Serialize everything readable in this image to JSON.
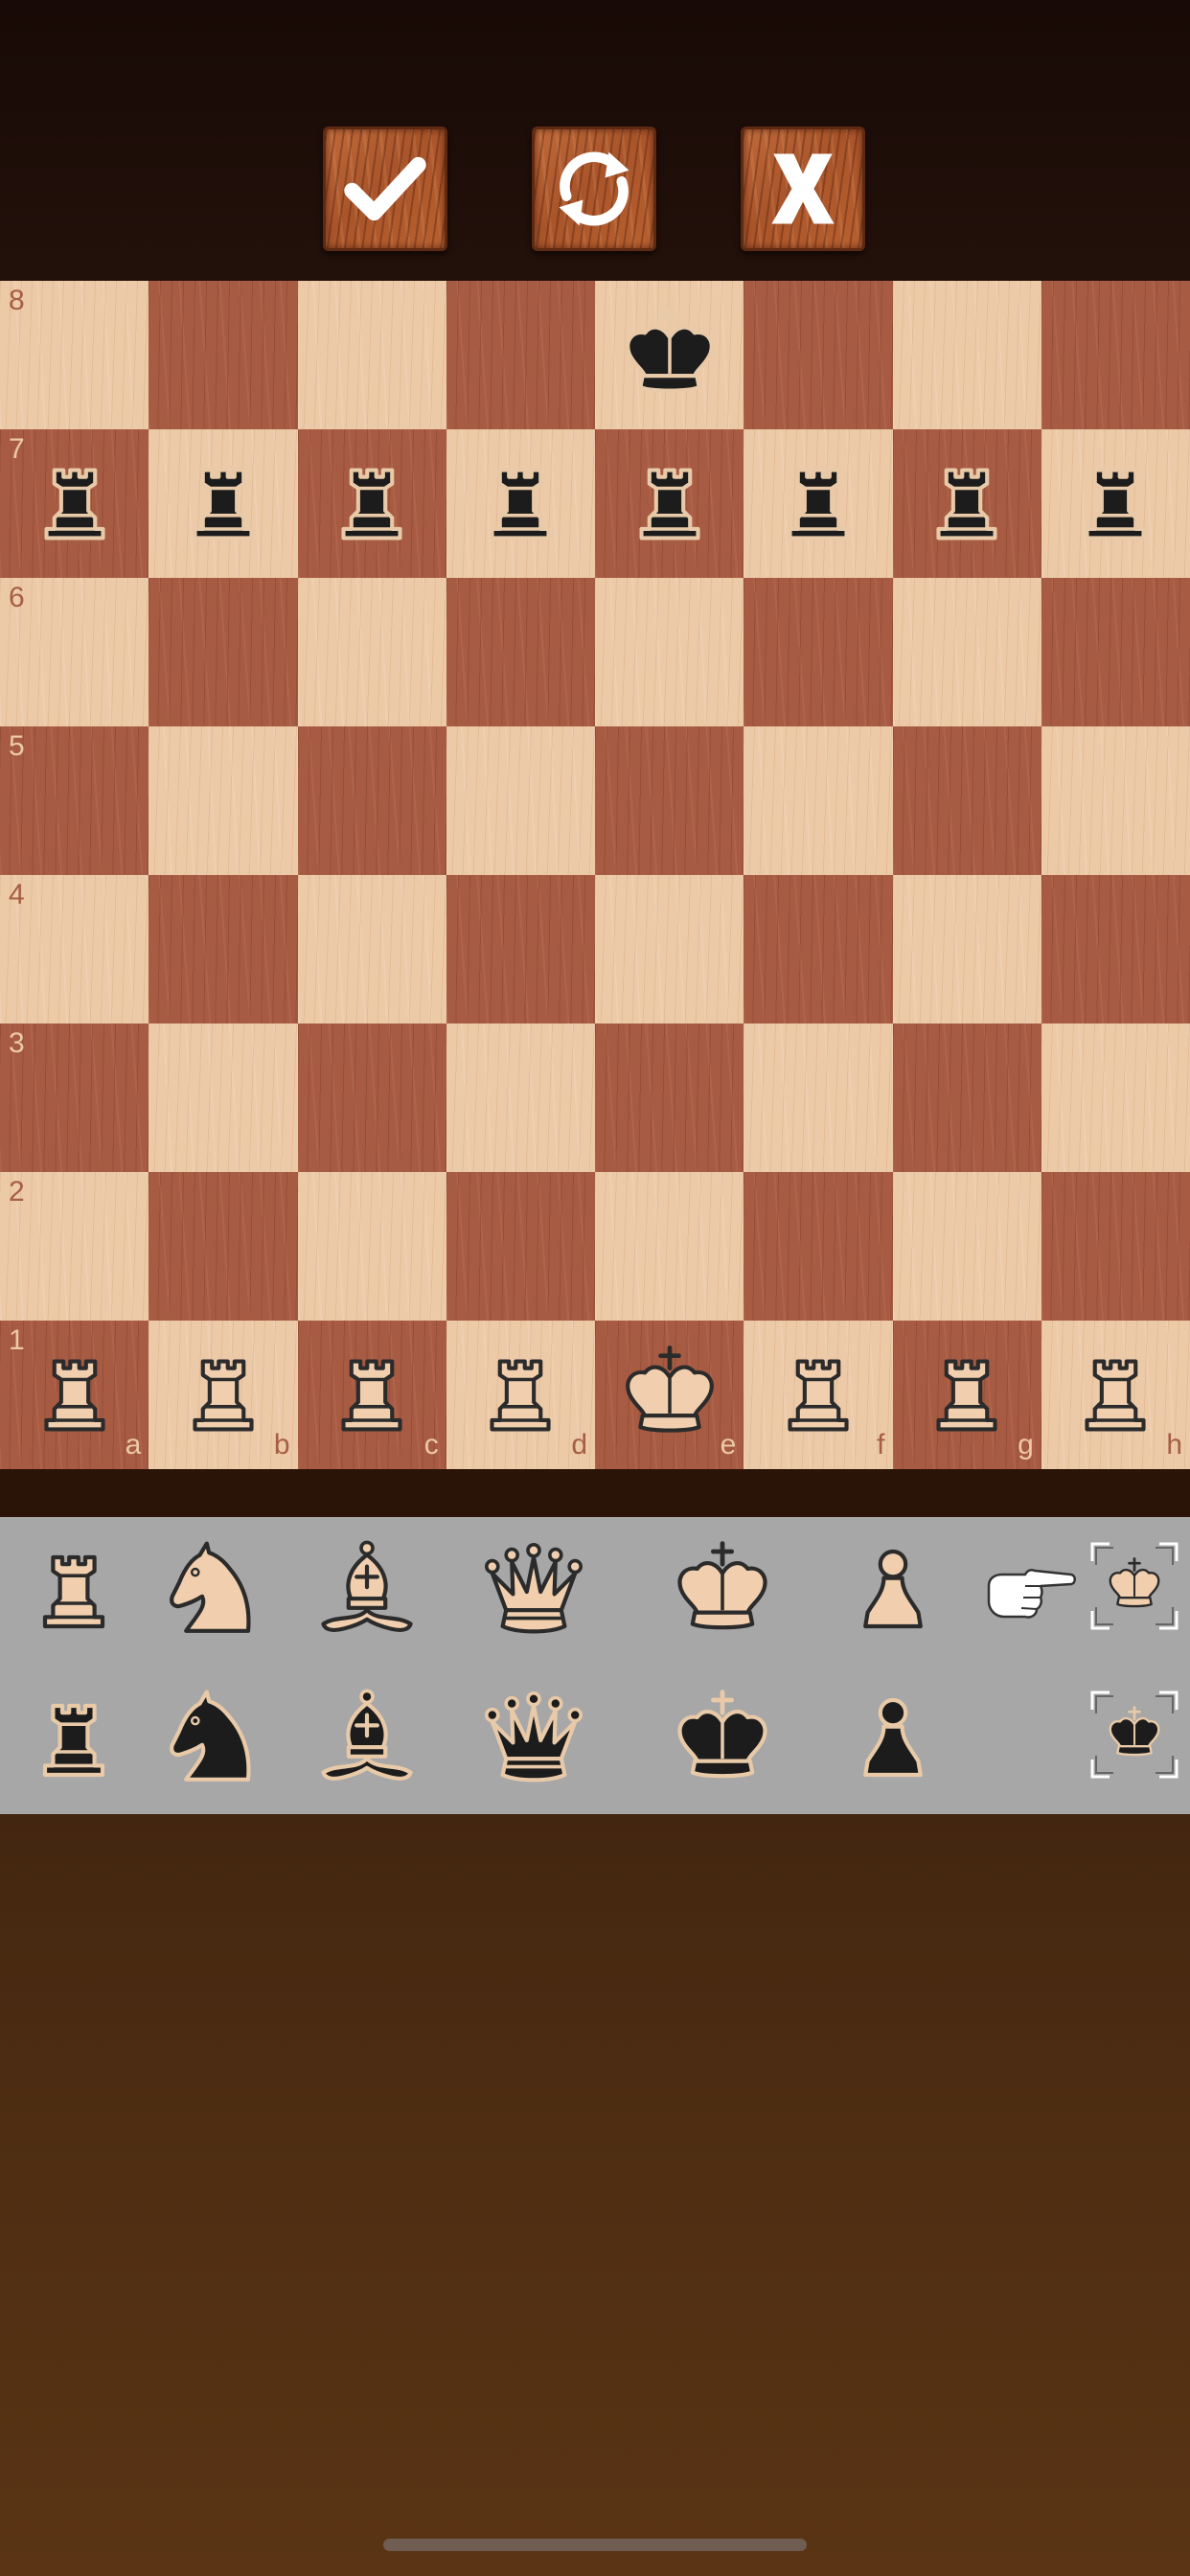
{
  "colors": {
    "light_square": "#eccaa8",
    "dark_square": "#a75b43",
    "white_piece_fill": "#f1cfae",
    "black_piece_fill": "#1c1c1c",
    "palette_background": "#a7a7a7",
    "button_wood": "#b25d31"
  },
  "toolbar": {
    "buttons": [
      {
        "name": "confirm",
        "icon": "checkmark-icon"
      },
      {
        "name": "rotate-board",
        "icon": "rotate-arrows-icon"
      },
      {
        "name": "cancel",
        "icon": "x-icon"
      }
    ]
  },
  "board": {
    "ranks": [
      "8",
      "7",
      "6",
      "5",
      "4",
      "3",
      "2",
      "1"
    ],
    "files": [
      "a",
      "b",
      "c",
      "d",
      "e",
      "f",
      "g",
      "h"
    ],
    "pieces": [
      {
        "square": "e8",
        "color": "black",
        "type": "king"
      },
      {
        "square": "a7",
        "color": "black",
        "type": "rook"
      },
      {
        "square": "b7",
        "color": "black",
        "type": "rook"
      },
      {
        "square": "c7",
        "color": "black",
        "type": "rook"
      },
      {
        "square": "d7",
        "color": "black",
        "type": "rook"
      },
      {
        "square": "e7",
        "color": "black",
        "type": "rook"
      },
      {
        "square": "f7",
        "color": "black",
        "type": "rook"
      },
      {
        "square": "g7",
        "color": "black",
        "type": "rook"
      },
      {
        "square": "h7",
        "color": "black",
        "type": "rook"
      },
      {
        "square": "a1",
        "color": "white",
        "type": "rook"
      },
      {
        "square": "b1",
        "color": "white",
        "type": "rook"
      },
      {
        "square": "c1",
        "color": "white",
        "type": "rook"
      },
      {
        "square": "d1",
        "color": "white",
        "type": "rook"
      },
      {
        "square": "e1",
        "color": "white",
        "type": "king"
      },
      {
        "square": "f1",
        "color": "white",
        "type": "rook"
      },
      {
        "square": "g1",
        "color": "white",
        "type": "rook"
      },
      {
        "square": "h1",
        "color": "white",
        "type": "rook"
      }
    ]
  },
  "palette": {
    "white_pieces": [
      "rook",
      "knight",
      "bishop",
      "queen",
      "king",
      "pawn"
    ],
    "black_pieces": [
      "rook",
      "knight",
      "bishop",
      "queen",
      "king",
      "pawn"
    ],
    "selected_side": "white",
    "pointer_icon": "pointing-hand-icon",
    "side_selector_icon": "king-frame-icon"
  }
}
